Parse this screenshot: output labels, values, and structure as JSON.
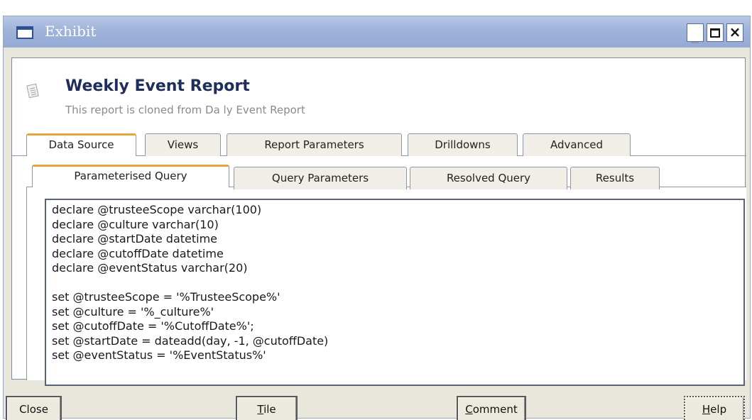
{
  "window": {
    "title": "Exhibit",
    "minimize": "_",
    "close": "×"
  },
  "report": {
    "title": "Weekly Event Report",
    "subtitle": "This report is cloned from Da ly Event Report"
  },
  "tabs": [
    {
      "label": "Data Source",
      "active": true
    },
    {
      "label": "Views",
      "active": false
    },
    {
      "label": "Report Parameters",
      "active": false
    },
    {
      "label": "Drilldowns",
      "active": false
    },
    {
      "label": "Advanced",
      "active": false
    }
  ],
  "subtabs": [
    {
      "label": "Parameterised Query",
      "active": true
    },
    {
      "label": "Query Parameters",
      "active": false
    },
    {
      "label": "Resolved Query",
      "active": false
    },
    {
      "label": "Results",
      "active": false
    }
  ],
  "query": {
    "text": "declare @trusteeScope varchar(100)\ndeclare @culture varchar(10)\ndeclare @startDate datetime\ndeclare @cutoffDate datetime\ndeclare @eventStatus varchar(20)\n\nset @trusteeScope = '%TrusteeScope%'\nset @culture = '%_culture%'\nset @cutoffDate = '%CutoffDate%';\nset @startDate = dateadd(day, -1, @cutoffDate)\nset @eventStatus = '%EventStatus%'"
  },
  "buttons": {
    "close": "Close",
    "tile_key": "T",
    "tile_rest": "ile",
    "comment_key": "C",
    "comment_rest": "omment",
    "help_key": "H",
    "help_rest": "elp"
  }
}
